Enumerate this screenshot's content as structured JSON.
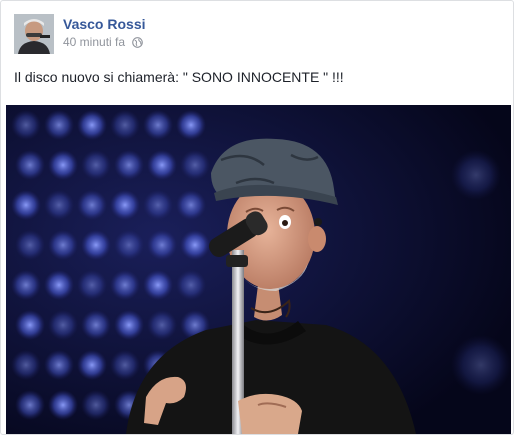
{
  "post": {
    "author": "Vasco Rossi",
    "timestamp": "40 minuti fa",
    "privacy_icon": "globe-icon",
    "text": "Il disco nuovo si chiamerà: \" SONO INNOCENTE \" !!!"
  },
  "colors": {
    "author_link": "#365899",
    "meta_text": "#90949c",
    "body_text": "#1d2129",
    "border": "#dddfe2",
    "stage_light": "#4a5cd8"
  }
}
